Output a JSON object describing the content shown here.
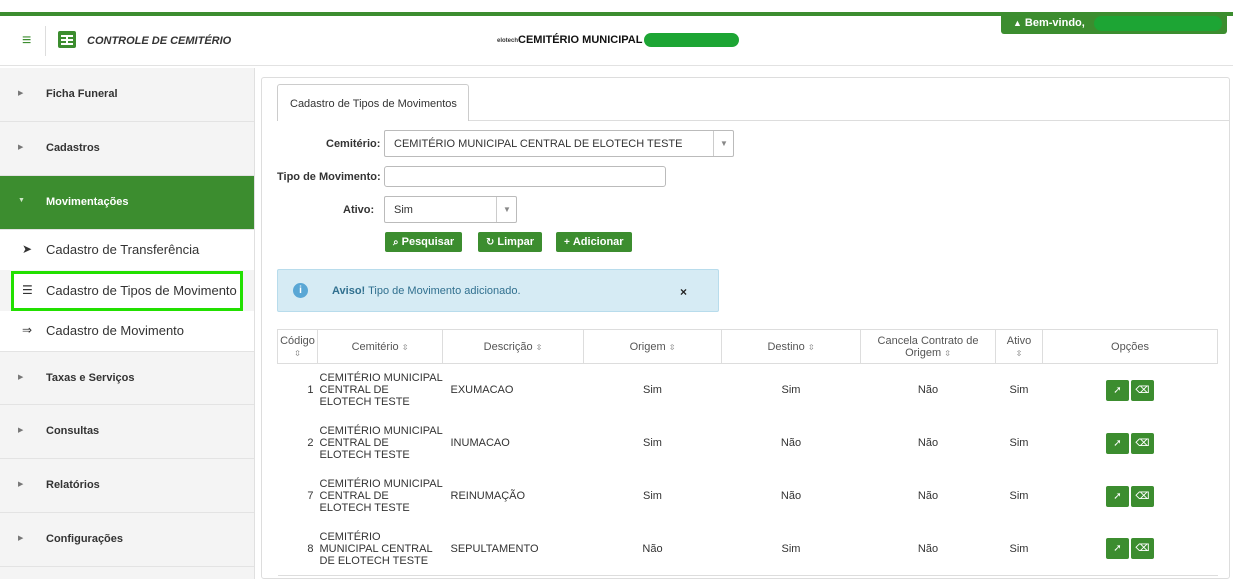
{
  "header": {
    "app_title": "CONTROLE DE CEMITÉRIO",
    "brand_small": "elotech",
    "brand_title": "CEMITÉRIO MUNICIPAL",
    "welcome": "Bem-vindo,"
  },
  "sidebar": {
    "items": [
      {
        "label": "Ficha Funeral"
      },
      {
        "label": "Cadastros"
      },
      {
        "label": "Movimentações"
      },
      {
        "label": "Taxas e Serviços"
      },
      {
        "label": "Consultas"
      },
      {
        "label": "Relatórios"
      },
      {
        "label": "Configurações"
      }
    ],
    "subitems": [
      {
        "label": "Cadastro de Transferência",
        "icon": "arrow-circle-right-icon"
      },
      {
        "label": "Cadastro de Tipos de Movimento",
        "icon": "list-icon"
      },
      {
        "label": "Cadastro de Movimento",
        "icon": "sign-in-icon"
      }
    ]
  },
  "form": {
    "tab_label": "Cadastro de Tipos de Movimentos",
    "cemiterio_label": "Cemitério:",
    "cemiterio_value": "CEMITÉRIO MUNICIPAL CENTRAL DE ELOTECH TESTE",
    "tipo_label": "Tipo de Movimento:",
    "tipo_value": "",
    "ativo_label": "Ativo:",
    "ativo_value": "Sim",
    "btn_pesquisar": "Pesquisar",
    "btn_limpar": "Limpar",
    "btn_adicionar": "Adicionar"
  },
  "alert": {
    "title": "Aviso!",
    "message": "Tipo de Movimento adicionado.",
    "close": "×"
  },
  "table": {
    "headers": {
      "codigo": "Código",
      "cemiterio": "Cemitério",
      "descricao": "Descrição",
      "origem": "Origem",
      "destino": "Destino",
      "cancela": "Cancela Contrato de Origem",
      "ativo": "Ativo",
      "opcoes": "Opções"
    },
    "rows": [
      {
        "codigo": "1",
        "cemiterio": "CEMITÉRIO MUNICIPAL CENTRAL DE ELOTECH TESTE",
        "descricao": "EXUMACAO",
        "origem": "Sim",
        "destino": "Sim",
        "cancela": "Não",
        "ativo": "Sim"
      },
      {
        "codigo": "2",
        "cemiterio": "CEMITÉRIO MUNICIPAL CENTRAL DE ELOTECH TESTE",
        "descricao": "INUMACAO",
        "origem": "Sim",
        "destino": "Não",
        "cancela": "Não",
        "ativo": "Sim"
      },
      {
        "codigo": "7",
        "cemiterio": "CEMITÉRIO MUNICIPAL CENTRAL DE ELOTECH TESTE",
        "descricao": "REINUMAÇÃO",
        "origem": "Sim",
        "destino": "Não",
        "cancela": "Não",
        "ativo": "Sim"
      },
      {
        "codigo": "8",
        "cemiterio": "CEMITÉRIO MUNICIPAL CENTRAL DE ELOTECH TESTE",
        "descricao": "SEPULTAMENTO",
        "origem": "Não",
        "destino": "Sim",
        "cancela": "Não",
        "ativo": "Sim"
      }
    ]
  },
  "colors": {
    "brand_green": "#3c8d2f",
    "highlight_outline": "#22e000",
    "alert_bg": "#d6ebf4"
  }
}
